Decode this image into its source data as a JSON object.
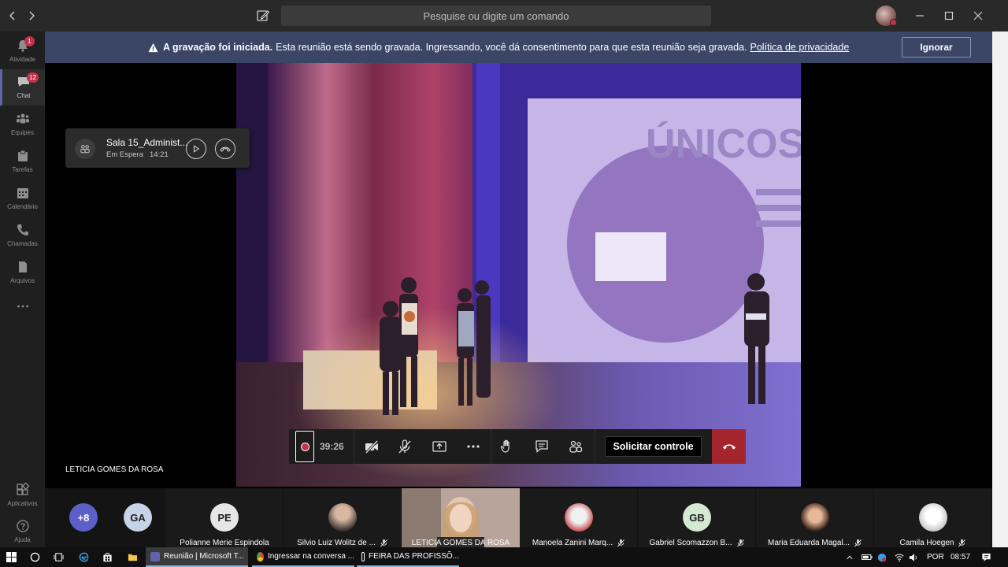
{
  "titlebar": {
    "search_placeholder": "Pesquise ou digite um comando"
  },
  "rail": {
    "items": [
      {
        "label": "Atividade",
        "badge": "1",
        "icon": "bell-icon"
      },
      {
        "label": "Chat",
        "badge": "12",
        "icon": "chat-icon"
      },
      {
        "label": "Equipes",
        "icon": "teams-icon"
      },
      {
        "label": "Tarefas",
        "icon": "tasks-icon"
      },
      {
        "label": "Calendário",
        "icon": "calendar-icon"
      },
      {
        "label": "Chamadas",
        "icon": "phone-icon"
      },
      {
        "label": "Arquivos",
        "icon": "files-icon"
      },
      {
        "label": "Aplicativos",
        "icon": "apps-icon"
      },
      {
        "label": "Ajuda",
        "icon": "help-icon"
      }
    ]
  },
  "banner": {
    "bold": "A gravação foi iniciada.",
    "text": "Esta reunião está sendo gravada. Ingressando, você dá consentimento para que esta reunião seja gravada.",
    "link": "Política de privacidade",
    "ignore_label": "Ignorar"
  },
  "hold_call": {
    "title": "Sala 15_Administ...",
    "status": "Em Espera",
    "time": "14:21"
  },
  "video": {
    "presenter": "LETICIA GOMES DA ROSA",
    "slide_text": "ÚNICOS"
  },
  "controls": {
    "duration": "39:26",
    "request_control_label": "Solicitar controle"
  },
  "participants": {
    "overflow": "+8",
    "ga_initials": "GA",
    "tiles": [
      {
        "name": "Polianne Merie Espindola",
        "initials": "PE",
        "muted": false
      },
      {
        "name": "Silvio Luiz Wolitz de ...",
        "initials": "",
        "muted": true
      },
      {
        "name": "LETICIA GOMES DA ROSA",
        "initials": "",
        "muted": false
      },
      {
        "name": "Manoela Zanini Marq...",
        "initials": "",
        "muted": true
      },
      {
        "name": "Gabriel Scomazzon B...",
        "initials": "GB",
        "muted": true
      },
      {
        "name": "Maria Eduarda Magal...",
        "initials": "",
        "muted": true
      },
      {
        "name": "Camila Hoegen",
        "initials": "",
        "muted": true
      }
    ]
  },
  "taskbar": {
    "apps": [
      {
        "label": "Reunião | Microsoft T..."
      },
      {
        "label": "Ingressar na conversa ..."
      },
      {
        "label": "FEIRA DAS PROFISSÕ..."
      }
    ],
    "language": "POR",
    "clock": "08:57"
  },
  "colors": {
    "accent": "#6264a7",
    "banner": "#3b4566",
    "hangup": "#a4262c",
    "badge": "#c4314b"
  }
}
